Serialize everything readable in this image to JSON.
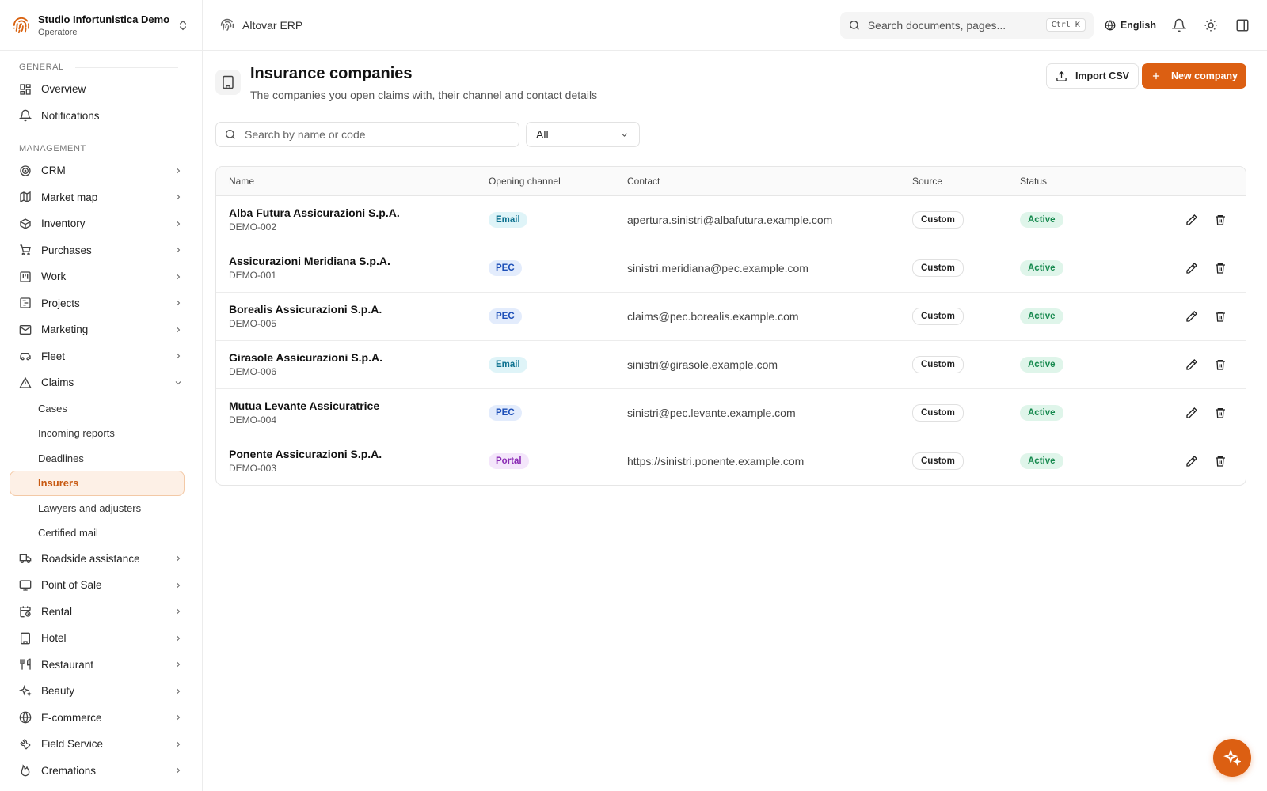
{
  "org": {
    "name": "Studio Infortunistica Demo",
    "role": "Operatore"
  },
  "app": {
    "name": "Altovar ERP"
  },
  "search": {
    "placeholder": "Search documents, pages...",
    "shortcut": "Ctrl K"
  },
  "language": "English",
  "sidebar": {
    "general_label": "GENERAL",
    "general_items": [
      {
        "label": "Overview",
        "icon": "grid-icon"
      },
      {
        "label": "Notifications",
        "icon": "bell-icon"
      }
    ],
    "management_label": "MANAGEMENT",
    "management_items": [
      {
        "label": "CRM"
      },
      {
        "label": "Market map"
      },
      {
        "label": "Inventory"
      },
      {
        "label": "Purchases"
      },
      {
        "label": "Work"
      },
      {
        "label": "Projects"
      },
      {
        "label": "Marketing"
      },
      {
        "label": "Fleet"
      },
      {
        "label": "Claims",
        "expanded": true
      }
    ],
    "claims_sub": [
      {
        "label": "Cases"
      },
      {
        "label": "Incoming reports"
      },
      {
        "label": "Deadlines"
      },
      {
        "label": "Insurers",
        "active": true
      },
      {
        "label": "Lawyers and adjusters"
      },
      {
        "label": "Certified mail"
      }
    ],
    "more_items": [
      {
        "label": "Roadside assistance"
      },
      {
        "label": "Point of Sale"
      },
      {
        "label": "Rental"
      },
      {
        "label": "Hotel"
      },
      {
        "label": "Restaurant"
      },
      {
        "label": "Beauty"
      },
      {
        "label": "E-commerce"
      },
      {
        "label": "Field Service"
      },
      {
        "label": "Cremations"
      }
    ]
  },
  "page": {
    "title": "Insurance companies",
    "subtitle": "The companies you open claims with, their channel and contact details",
    "import_label": "Import CSV",
    "new_label": "New company"
  },
  "filters": {
    "search_placeholder": "Search by name or code",
    "select_value": "All"
  },
  "table": {
    "columns": [
      "Name",
      "Opening channel",
      "Contact",
      "Source",
      "Status",
      ""
    ],
    "rows": [
      {
        "name": "Alba Futura Assicurazioni S.p.A.",
        "code": "DEMO-002",
        "channel": "Email",
        "contact": "apertura.sinistri@albafutura.example.com",
        "source": "Custom",
        "status": "Active"
      },
      {
        "name": "Assicurazioni Meridiana S.p.A.",
        "code": "DEMO-001",
        "channel": "PEC",
        "contact": "sinistri.meridiana@pec.example.com",
        "source": "Custom",
        "status": "Active"
      },
      {
        "name": "Borealis Assicurazioni S.p.A.",
        "code": "DEMO-005",
        "channel": "PEC",
        "contact": "claims@pec.borealis.example.com",
        "source": "Custom",
        "status": "Active"
      },
      {
        "name": "Girasole Assicurazioni S.p.A.",
        "code": "DEMO-006",
        "channel": "Email",
        "contact": "sinistri@girasole.example.com",
        "source": "Custom",
        "status": "Active"
      },
      {
        "name": "Mutua Levante Assicuratrice",
        "code": "DEMO-004",
        "channel": "PEC",
        "contact": "sinistri@pec.levante.example.com",
        "source": "Custom",
        "status": "Active"
      },
      {
        "name": "Ponente Assicurazioni S.p.A.",
        "code": "DEMO-003",
        "channel": "Portal",
        "contact": "https://sinistri.ponente.example.com",
        "source": "Custom",
        "status": "Active"
      }
    ]
  },
  "colors": {
    "accent": "#dc5f12",
    "active_bg": "#dff5ea",
    "active_fg": "#16894e"
  }
}
